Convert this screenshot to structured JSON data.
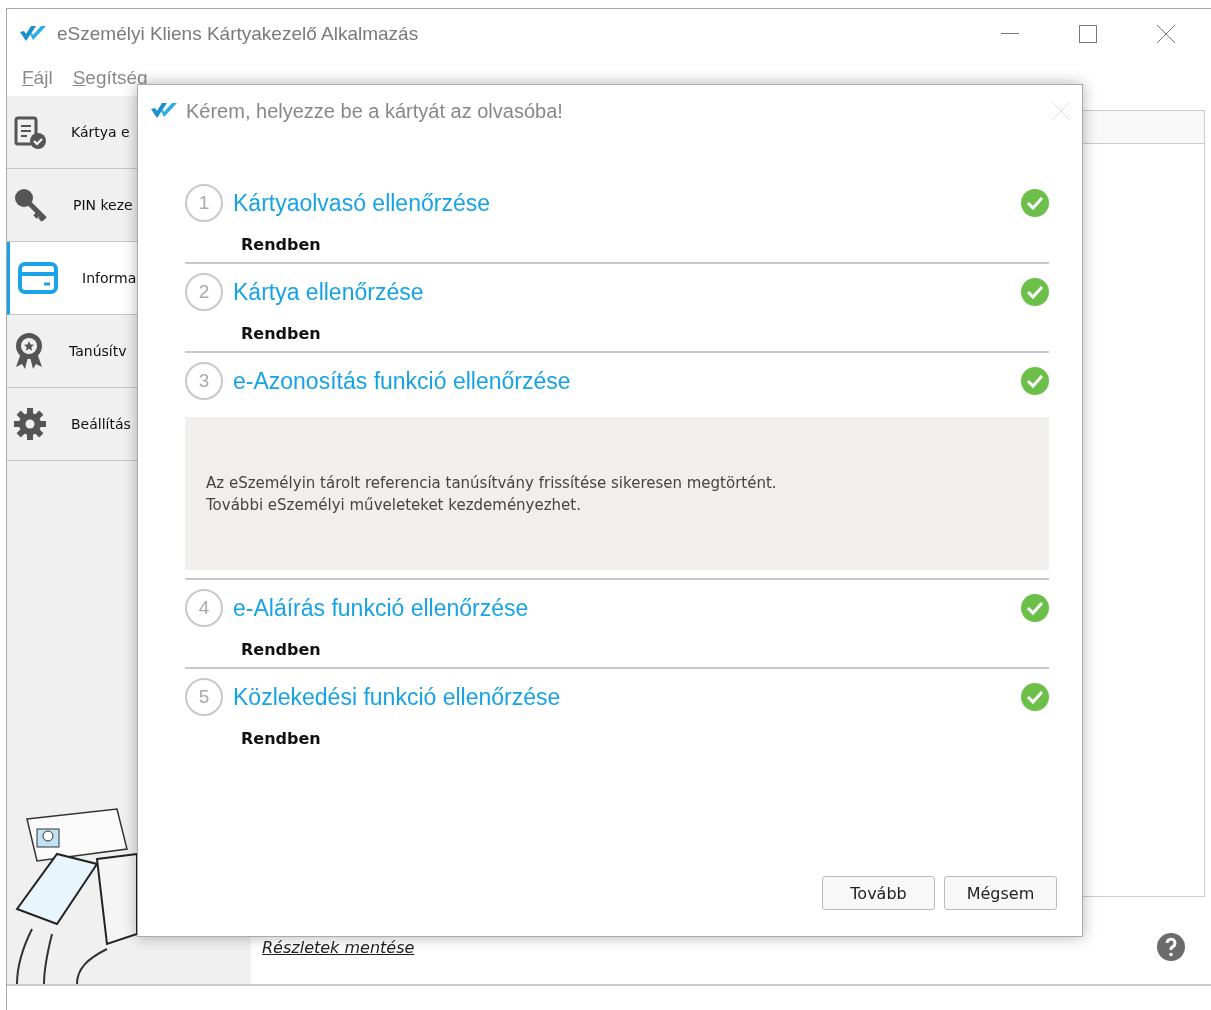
{
  "window": {
    "title": "eSzemélyi Kliens Kártyakezelő Alkalmazás"
  },
  "menu": [
    {
      "label": "Fájl"
    },
    {
      "label": "Segítség"
    }
  ],
  "sidebar": {
    "items": [
      {
        "label": "Kártya e",
        "selected": false
      },
      {
        "label": "PIN keze",
        "selected": false
      },
      {
        "label": "Informa",
        "selected": true
      },
      {
        "label": "Tanúsítv",
        "selected": false
      },
      {
        "label": "Beállítás",
        "selected": false
      }
    ]
  },
  "link": "Részletek mentése",
  "dialog": {
    "title": "Kérem, helyezze be a kártyát az olvasóba!",
    "steps": [
      {
        "number": "1",
        "title": "Kártyaolvasó ellenőrzése",
        "passed": true,
        "kind": "status",
        "text": "Rendben"
      },
      {
        "number": "2",
        "title": "Kártya ellenőrzése",
        "passed": true,
        "kind": "status",
        "text": "Rendben"
      },
      {
        "number": "3",
        "title": "e-Azonosítás funkció ellenőrzése",
        "passed": true,
        "kind": "message",
        "lines": [
          "Az eSzemélyin tárolt referencia tanúsítvány frissítése sikeresen megtörtént.",
          "További eSzemélyi műveleteket kezdeményezhet."
        ]
      },
      {
        "number": "4",
        "title": "e-Aláírás funkció ellenőrzése",
        "passed": true,
        "kind": "status",
        "text": "Rendben"
      },
      {
        "number": "5",
        "title": "Közlekedési funkció ellenőrzése",
        "passed": true,
        "kind": "status",
        "text": "Rendben"
      }
    ],
    "buttons": [
      "Tovább",
      "Mégsem"
    ]
  }
}
